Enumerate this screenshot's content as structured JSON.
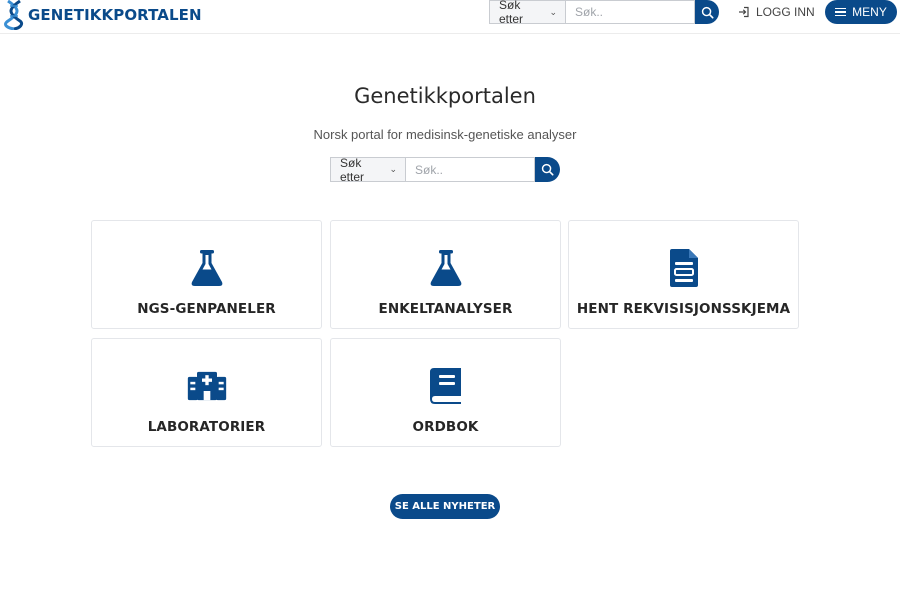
{
  "header": {
    "logo_text": "GENETIKKPORTALEN",
    "search": {
      "select_label": "Søk etter",
      "placeholder": "Søk..",
      "value": ""
    },
    "login_label": "LOGG INN",
    "menu_label": "MENY"
  },
  "hero": {
    "title": "Genetikkportalen",
    "subtitle": "Norsk portal for medisinsk-genetiske analyser",
    "search": {
      "select_label": "Søk etter",
      "placeholder": "Søk..",
      "value": ""
    }
  },
  "cards": [
    {
      "label": "NGS-GENPANELER",
      "icon": "flask-icon"
    },
    {
      "label": "ENKELTANALYSER",
      "icon": "flask-icon"
    },
    {
      "label": "HENT REKVISISJONSSKJEMA",
      "icon": "document-icon"
    },
    {
      "label": "LABORATORIER",
      "icon": "hospital-icon"
    },
    {
      "label": "ORDBOK",
      "icon": "book-icon"
    }
  ],
  "news_button_label": "SE ALLE NYHETER",
  "colors": {
    "brand": "#0a4a8a",
    "text": "#262626",
    "border": "#e4e6ea"
  }
}
